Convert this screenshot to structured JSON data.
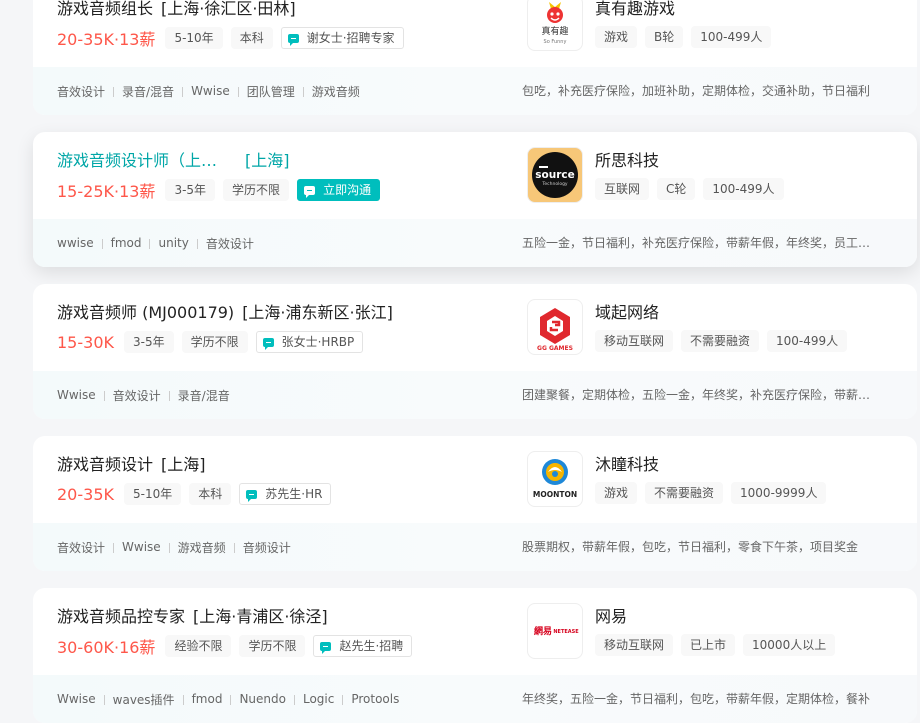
{
  "jobs": [
    {
      "title": "游戏音频组长",
      "location": "[上海·徐汇区·田林]",
      "salary": "20-35K·13薪",
      "experience": "5-10年",
      "degree": "本科",
      "recruiter": "谢女士·招聘专家",
      "skills": [
        "音效设计",
        "录音/混音",
        "Wwise",
        "团队管理",
        "游戏音频"
      ],
      "welfare": "包吃，补充医疗保险，加班补助，定期体检，交通补助，节日福利",
      "company": {
        "name": "真有趣游戏",
        "tags": [
          "游戏",
          "B轮",
          "100-499人"
        ],
        "logo_text": "真有趣",
        "logo_sub": "So Funny"
      }
    },
    {
      "title": "游戏音频设计师（上海）",
      "location": "[上海]",
      "salary": "15-25K·13薪",
      "experience": "3-5年",
      "degree": "学历不限",
      "recruiter": "立即沟通",
      "skills": [
        "wwise",
        "fmod",
        "unity",
        "音效设计"
      ],
      "welfare": "五险一金，节日福利，补充医疗保险，带薪年假，年终奖，员工旅游",
      "company": {
        "name": "所思科技",
        "tags": [
          "互联网",
          "C轮",
          "100-499人"
        ],
        "logo_text": "source",
        "logo_sub": "Technology"
      }
    },
    {
      "title": "游戏音频师 (MJ000179)",
      "location": "[上海·浦东新区·张江]",
      "salary": "15-30K",
      "experience": "3-5年",
      "degree": "学历不限",
      "recruiter": "张女士·HRBP",
      "skills": [
        "Wwise",
        "音效设计",
        "录音/混音"
      ],
      "welfare": "团建聚餐，定期体检，五险一金，年终奖，补充医疗保险，带薪年假",
      "company": {
        "name": "域起网络",
        "tags": [
          "移动互联网",
          "不需要融资",
          "100-499人"
        ],
        "logo_text": "GG GAMES"
      }
    },
    {
      "title": "游戏音频设计",
      "location": "[上海]",
      "salary": "20-35K",
      "experience": "5-10年",
      "degree": "本科",
      "recruiter": "苏先生·HR",
      "skills": [
        "音效设计",
        "Wwise",
        "游戏音频",
        "音频设计"
      ],
      "welfare": "股票期权，带薪年假，包吃，节日福利，零食下午茶，项目奖金",
      "company": {
        "name": "沐瞳科技",
        "tags": [
          "游戏",
          "不需要融资",
          "1000-9999人"
        ],
        "logo_text": "MOONTON"
      }
    },
    {
      "title": "游戏音频品控专家",
      "location": "[上海·青浦区·徐泾]",
      "salary": "30-60K·16薪",
      "experience": "经验不限",
      "degree": "学历不限",
      "recruiter": "赵先生·招聘",
      "skills": [
        "Wwise",
        "waves插件",
        "fmod",
        "Nuendo",
        "Logic",
        "Protools"
      ],
      "welfare": "年终奖，五险一金，节日福利，包吃，带薪年假，定期体检，餐补",
      "company": {
        "name": "网易",
        "tags": [
          "移动互联网",
          "已上市",
          "10000人以上"
        ],
        "logo_text": "網易",
        "logo_sub": "NETEASE"
      }
    }
  ],
  "colors": {
    "accent": "#00bebd",
    "salary": "#fe574a",
    "title_active": "#00a6a7"
  }
}
